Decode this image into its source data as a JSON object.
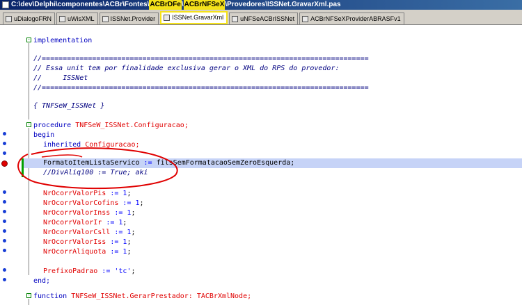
{
  "window": {
    "title_prefix": "C:\\dev\\Delphi\\componentes\\ACBr\\Fontes\\",
    "title_hl1": "ACBrDFe",
    "title_sep": "\\",
    "title_hl2": "ACBrNFSeX",
    "title_suffix": "\\Provedores\\ISSNet.GravarXml.pas"
  },
  "tabs": [
    {
      "label": "uDialogoFRN",
      "active": false
    },
    {
      "label": "uWisXML",
      "active": false
    },
    {
      "label": "ISSNet.Provider",
      "active": false
    },
    {
      "label": "ISSNet.GravarXml",
      "active": true
    },
    {
      "label": "uNFSeACBrISSNet",
      "active": false
    },
    {
      "label": "ACBrNFSeXProviderABRASFv1",
      "active": false
    }
  ],
  "code": {
    "implementation": "implementation",
    "sep1": "//==============================================================================",
    "comment1": "// Essa unit tem por finalidade exclusiva gerar o XML do RPS do provedor:",
    "comment2": "//     ISSNet",
    "sep2": "//==============================================================================",
    "class_comment": "{ TNFSeW_ISSNet }",
    "proc_kw": "procedure",
    "proc_name": "TNFSeW_ISSNet.Configuracao;",
    "begin_kw": "begin",
    "inherited_kw": "inherited",
    "inherited_call": "Configuracao;",
    "exec_var": "FormatoItemListaServico",
    "exec_op": " := ",
    "exec_val": "filsSemFormatacaoSemZeroEsquerda;",
    "commented": "//DivAliq100 := True; aki",
    "assign_op": " := ",
    "assignments": [
      {
        "var": "NrOcorrValorPis",
        "val": "1"
      },
      {
        "var": "NrOcorrValorCofins",
        "val": "1"
      },
      {
        "var": "NrOcorrValorInss",
        "val": "1"
      },
      {
        "var": "NrOcorrValorIr",
        "val": "1"
      },
      {
        "var": "NrOcorrValorCsll",
        "val": "1"
      },
      {
        "var": "NrOcorrValorIss",
        "val": "1"
      },
      {
        "var": "NrOcorrAliquota",
        "val": "1"
      }
    ],
    "prefix_var": "PrefixoPadrao",
    "prefix_val": "'tc'",
    "end_kw": "end;",
    "func_kw": "function",
    "func_name": "TNFSeW_ISSNet.GerarPrestador:",
    "func_type": "TACBrXmlNode;"
  },
  "colors": {
    "keyword": "#0000c0",
    "identifier": "#e00000",
    "comment": "#000080",
    "execution_line": "#c6d3f7",
    "breakpoint": "#e00000",
    "highlight": "#f5e21a"
  }
}
